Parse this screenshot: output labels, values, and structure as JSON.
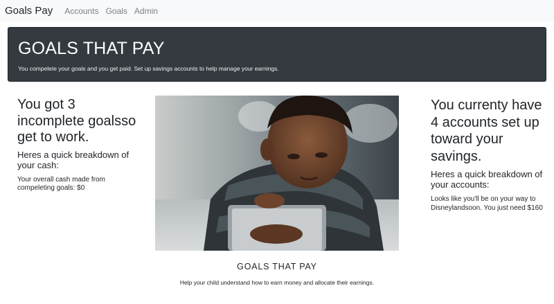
{
  "navbar": {
    "brand": "Goals Pay",
    "links": [
      "Accounts",
      "Goals",
      "Admin"
    ]
  },
  "jumbotron": {
    "title": "GOALS THAT PAY",
    "subtitle": "You compelete your goals and you get paid. Set up savings accounts to help manage your earnings."
  },
  "left": {
    "headline": "You got 3 incomplete goalsso get to work.",
    "subheading": "Heres a quick breakdown of your cash:",
    "detail": "Your overall cash made from compeleting goals: $0"
  },
  "right": {
    "headline": "You currenty have 4 accounts set up toward your savings.",
    "subheading": "Heres a quick breakdown of your accounts:",
    "detail": "Looks like you'll be on your way to Disneylandsoon. You just need $160"
  },
  "footer": {
    "title": "GOALS THAT PAY",
    "subtitle": "Help your child understand how to earn money and allocate their earnings."
  },
  "colors": {
    "navbar_bg": "#f8f9fa",
    "jumbotron_bg": "#343a40"
  }
}
